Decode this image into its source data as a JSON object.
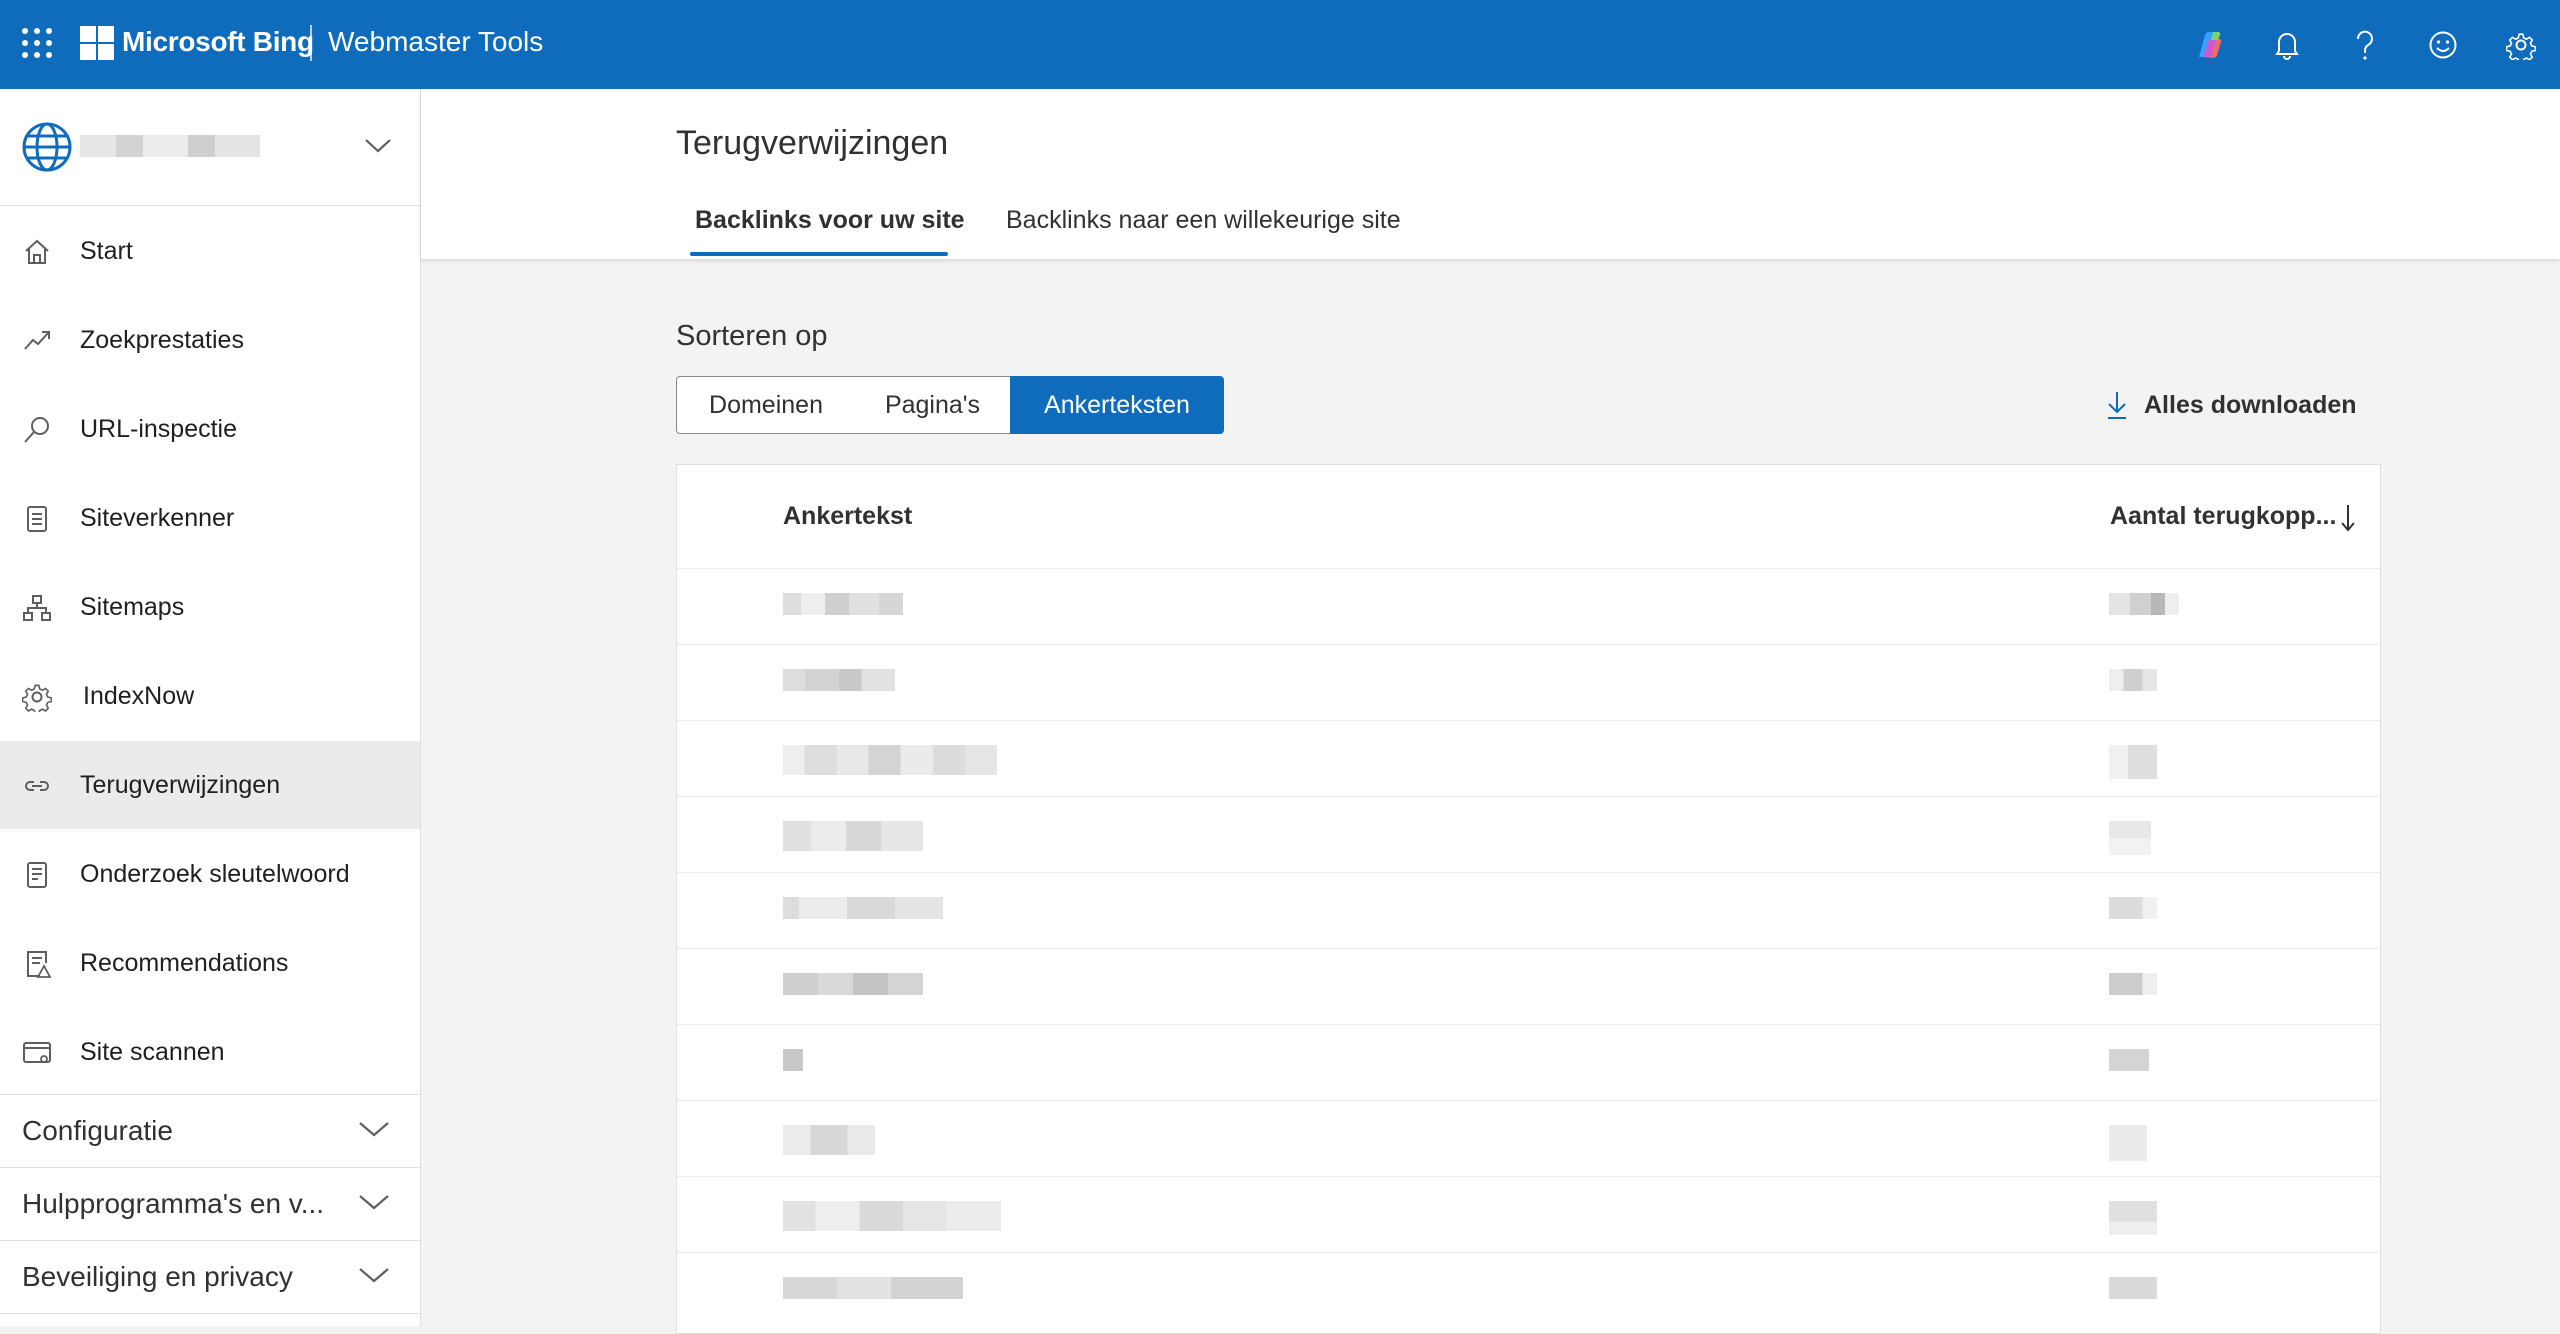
{
  "header": {
    "brand": "Microsoft Bing",
    "product": "Webmaster Tools",
    "icons": [
      "apps-waffle-icon",
      "copilot-icon",
      "bell-icon",
      "help-icon",
      "feedback-smiley-icon",
      "settings-gear-icon"
    ]
  },
  "sidebar": {
    "site_selector": {
      "icon": "globe-icon",
      "value_redacted": true
    },
    "items": [
      {
        "label": "Start",
        "icon": "home-icon"
      },
      {
        "label": "Zoekprestaties",
        "icon": "trend-icon"
      },
      {
        "label": "URL-inspectie",
        "icon": "search-icon"
      },
      {
        "label": "Siteverkenner",
        "icon": "document-list-icon"
      },
      {
        "label": "Sitemaps",
        "icon": "sitemap-icon"
      },
      {
        "label": "IndexNow",
        "icon": "gear-icon"
      },
      {
        "label": "Terugverwijzingen",
        "icon": "link-icon",
        "active": true
      },
      {
        "label": "Onderzoek sleutelwoord",
        "icon": "document-icon"
      },
      {
        "label": "Recommendations",
        "icon": "document-warning-icon"
      },
      {
        "label": "Site scannen",
        "icon": "browser-scan-icon"
      }
    ],
    "sections": [
      {
        "label": "Configuratie"
      },
      {
        "label": "Hulpprogramma's en v..."
      },
      {
        "label": "Beveiliging en privacy"
      }
    ]
  },
  "main": {
    "title": "Terugverwijzingen",
    "tabs": [
      {
        "label": "Backlinks voor uw site",
        "active": true
      },
      {
        "label": "Backlinks naar een willekeurige site",
        "active": false
      }
    ],
    "sort_label": "Sorteren op",
    "sort_options": [
      {
        "label": "Domeinen",
        "selected": false
      },
      {
        "label": "Pagina's",
        "selected": false
      },
      {
        "label": "Ankerteksten",
        "selected": true
      }
    ],
    "download_label": "Alles downloaden",
    "table": {
      "columns": [
        "Ankertekst",
        "Aantal terugkopp..."
      ],
      "sort_column": "Aantal terugkopp...",
      "sort_direction": "descending",
      "rows_redacted": 10
    }
  },
  "colors": {
    "brand_blue": "#0f6cbd",
    "page_bg": "#f3f3f3",
    "sidebar_active": "#ebebeb"
  }
}
